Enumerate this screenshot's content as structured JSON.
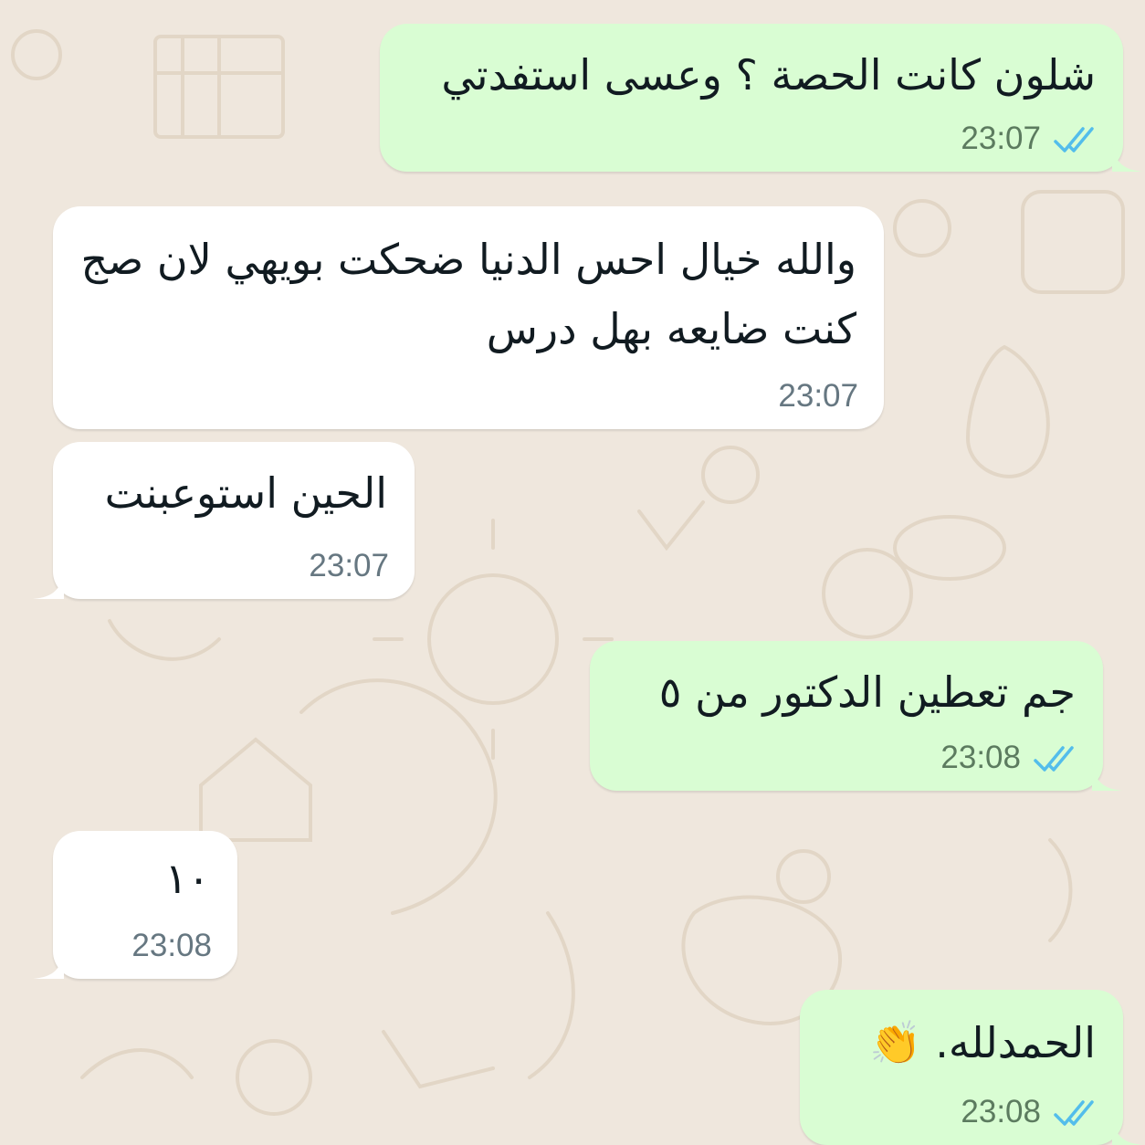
{
  "colors": {
    "wallpaper": "#efe7dd",
    "outgoing_bubble": "#d9fdd3",
    "incoming_bubble": "#ffffff",
    "read_ticks": "#53bdeb",
    "timestamp": "#667781"
  },
  "icons": {
    "read_receipt": "double-check-icon"
  },
  "messages": [
    {
      "direction": "outgoing",
      "text": "شلون كانت الحصة ؟ وعسى استفدتي",
      "time": "23:07",
      "status": "read"
    },
    {
      "direction": "incoming",
      "text": "والله خيال احس الدنيا ضحكت بويهي لان صج كنت ضايعه بهل درس",
      "time": "23:07"
    },
    {
      "direction": "incoming",
      "text": "الحين استوعبنت",
      "time": "23:07"
    },
    {
      "direction": "outgoing",
      "text": "جم تعطين الدكتور من ٥",
      "time": "23:08",
      "status": "read"
    },
    {
      "direction": "incoming",
      "text": "١٠",
      "time": "23:08"
    },
    {
      "direction": "outgoing",
      "text": "الحمدلله. 👏",
      "time": "23:08",
      "status": "read"
    }
  ]
}
